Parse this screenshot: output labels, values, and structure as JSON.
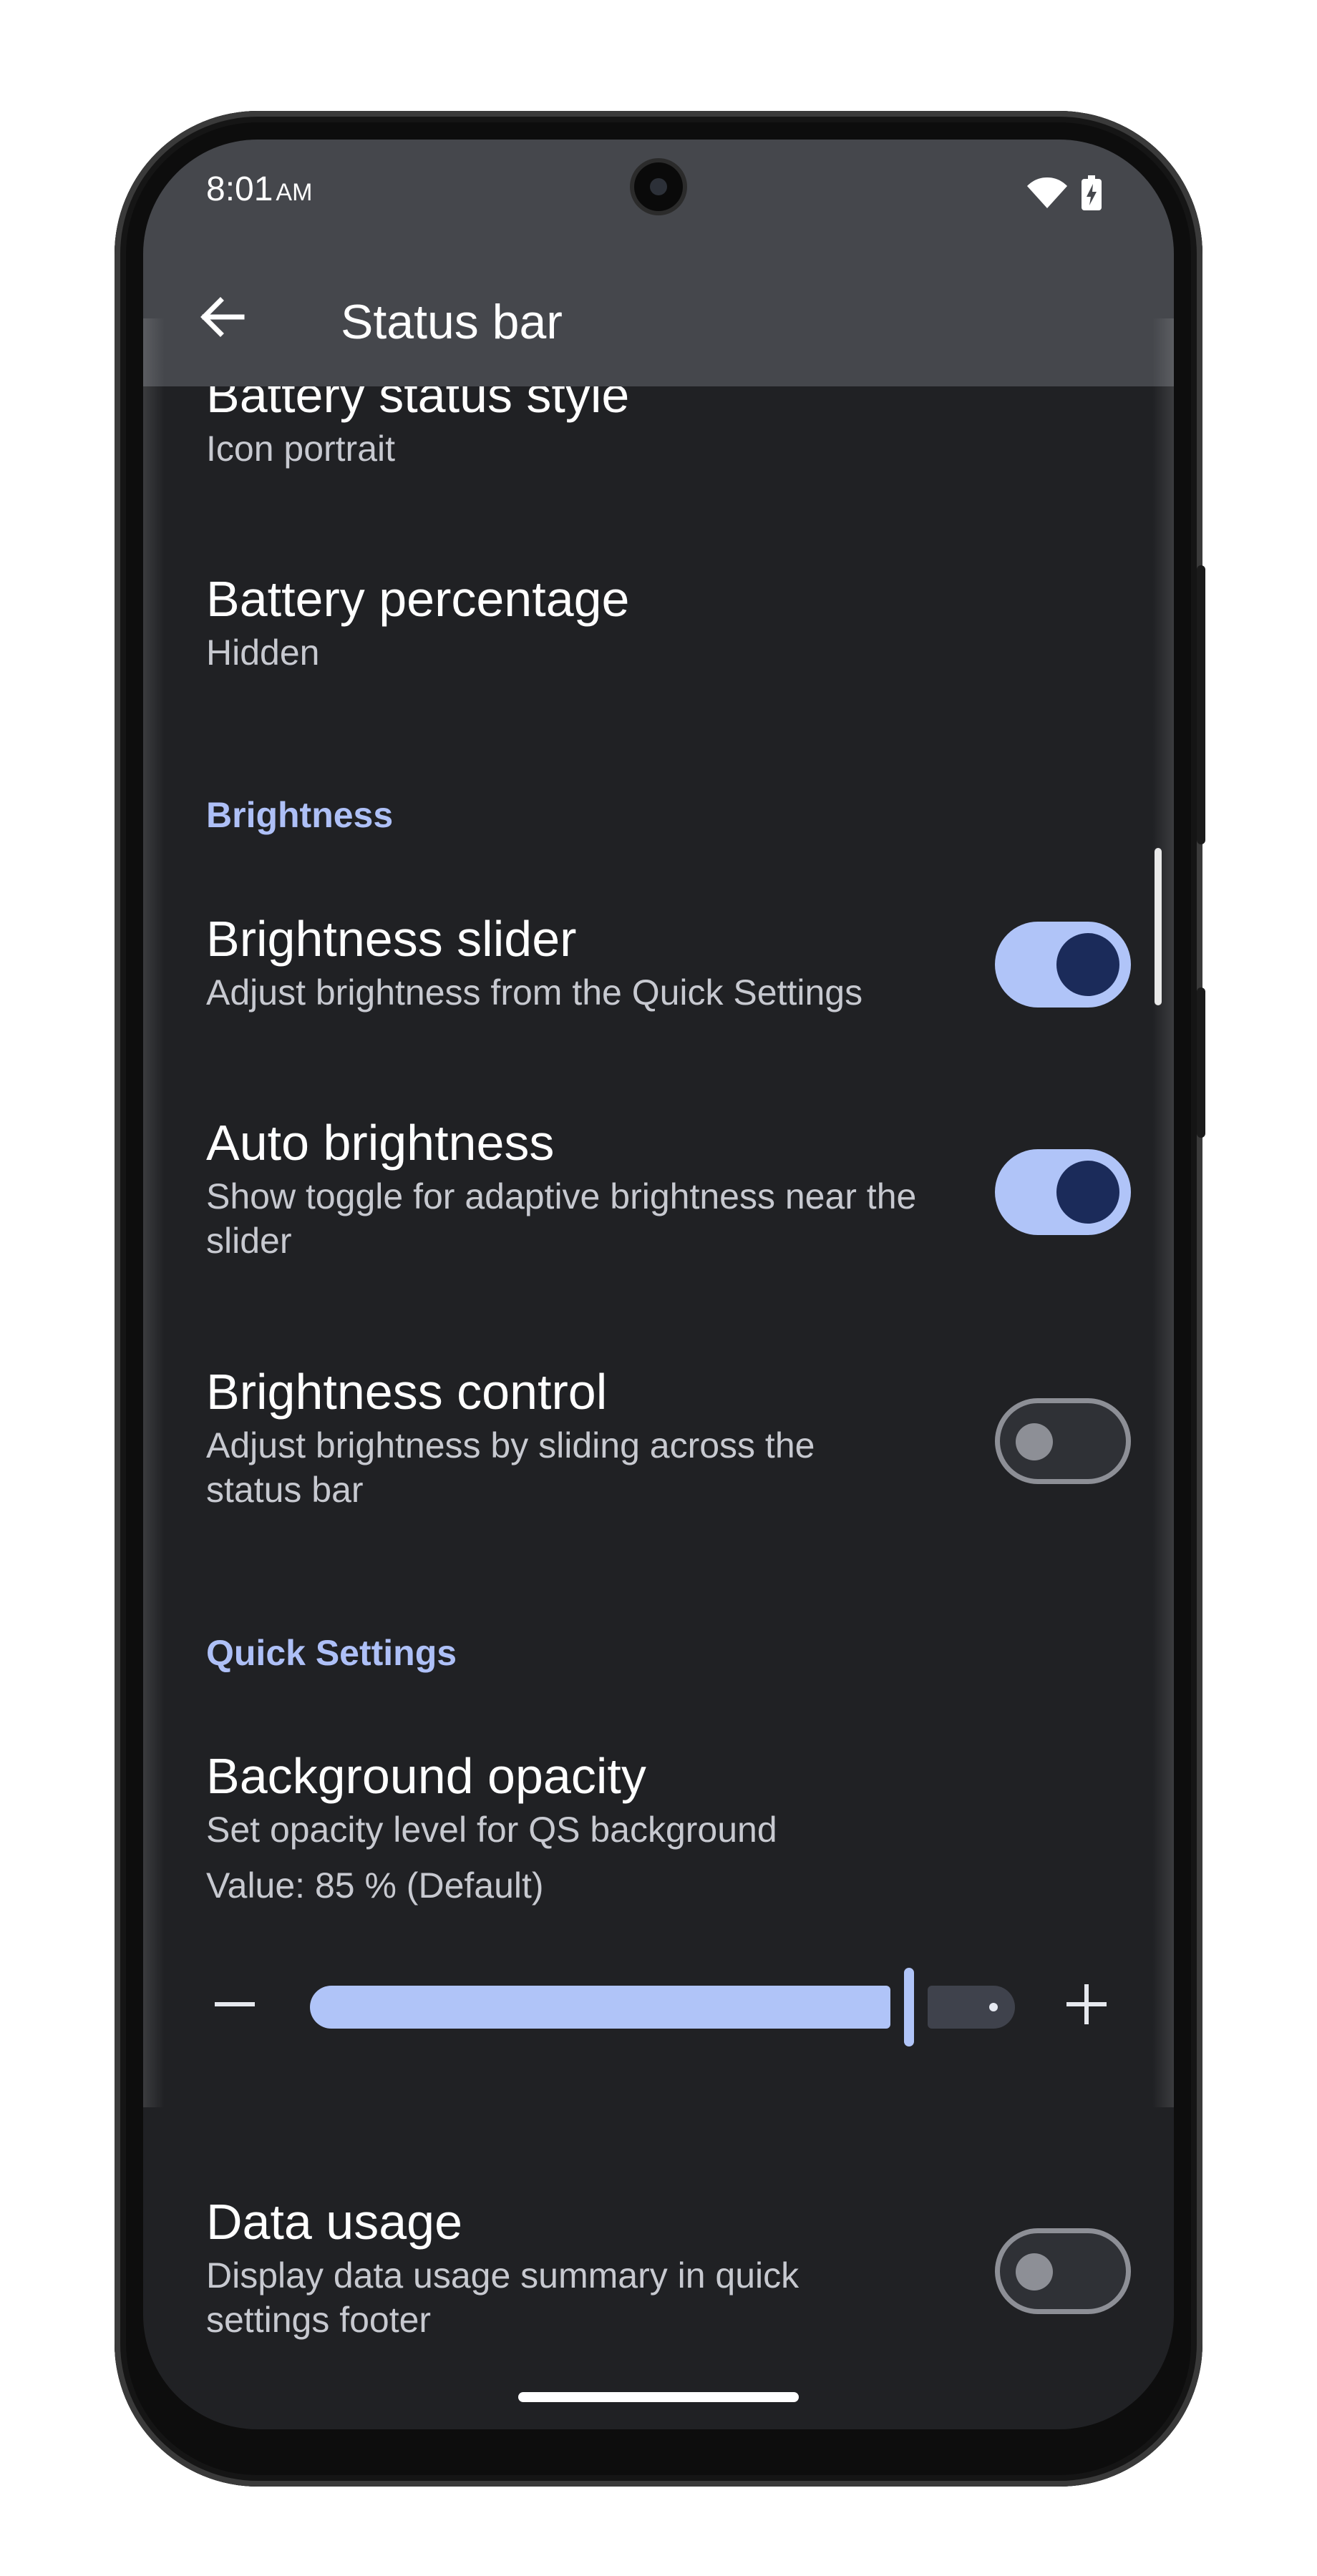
{
  "status_bar": {
    "time": "8:01",
    "ampm": "AM"
  },
  "app_bar": {
    "back_icon": "arrow-left-icon",
    "title": "Status bar"
  },
  "settings": {
    "battery_status_style": {
      "title": "Battery status style",
      "subtitle": "Icon portrait"
    },
    "battery_percentage": {
      "title": "Battery percentage",
      "subtitle": "Hidden"
    },
    "brightness_section": "Brightness",
    "brightness_slider": {
      "title": "Brightness slider",
      "subtitle": "Adjust brightness from the Quick Settings",
      "enabled": true
    },
    "auto_brightness": {
      "title": "Auto brightness",
      "subtitle": "Show toggle for adaptive brightness near the slider",
      "enabled": true
    },
    "brightness_control": {
      "title": "Brightness control",
      "subtitle": "Adjust brightness by sliding across the status bar",
      "enabled": false
    },
    "quick_settings_section": "Quick Settings",
    "background_opacity": {
      "title": "Background opacity",
      "subtitle": "Set opacity level for QS background",
      "value_text": "Value: 85 % (Default)",
      "value_percent": 85,
      "minus_label": "−",
      "plus_label": "+"
    },
    "data_usage": {
      "title": "Data usage",
      "subtitle": "Display data usage summary in quick settings footer",
      "enabled": false
    }
  },
  "colors": {
    "accent": "#b0c4f8",
    "surface": "#202124",
    "bar": "#45474c",
    "knob_on": "#1b2b5a"
  }
}
